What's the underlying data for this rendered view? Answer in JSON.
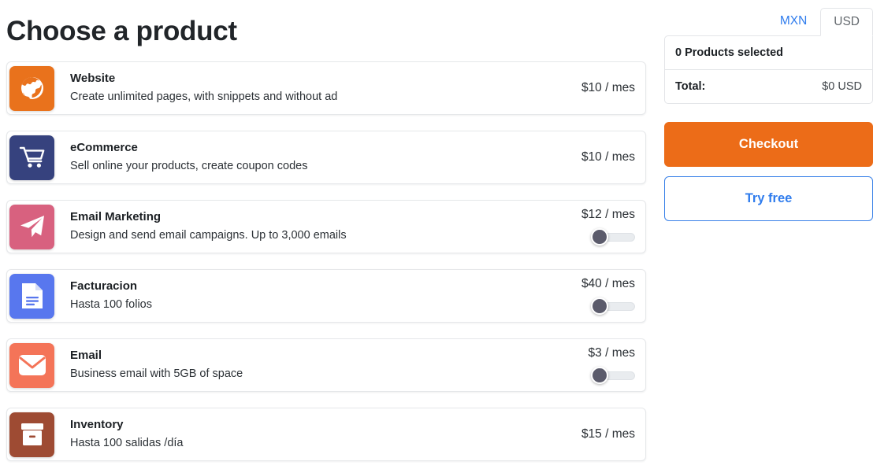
{
  "page": {
    "title": "Choose a product",
    "background": "#ffffff"
  },
  "colors": {
    "accent_orange": "#ec6c18",
    "accent_blue": "#2f7ced",
    "text": "#212529",
    "card_border": "#e6e8ea"
  },
  "products": [
    {
      "icon": "globe-icon",
      "icon_bg": "#e9721c",
      "name": "Website",
      "description": "Create unlimited pages, with snippets and without ad",
      "price": "$10 / mes",
      "has_toggle": false,
      "toggle_state": "off"
    },
    {
      "icon": "shopping-cart-icon",
      "icon_bg": "#36427e",
      "name": "eCommerce",
      "description": "Sell online your products, create coupon codes",
      "price": "$10 / mes",
      "has_toggle": false,
      "toggle_state": "off"
    },
    {
      "icon": "paper-plane-icon",
      "icon_bg": "#d8617f",
      "name": "Email Marketing",
      "description": "Design and send email campaigns. Up to 3,000 emails",
      "price": "$12 / mes",
      "has_toggle": true,
      "toggle_state": "off"
    },
    {
      "icon": "document-icon",
      "icon_bg": "#5877ee",
      "name": "Facturacion",
      "description": "Hasta 100 folios",
      "price": "$40 / mes",
      "has_toggle": true,
      "toggle_state": "off"
    },
    {
      "icon": "envelope-icon",
      "icon_bg": "#f47458",
      "name": "Email",
      "description": "Business email with 5GB of space",
      "price": "$3 / mes",
      "has_toggle": true,
      "toggle_state": "off"
    },
    {
      "icon": "box-icon",
      "icon_bg": "#9e4b33",
      "name": "Inventory",
      "description": "Hasta 100 salidas /día",
      "price": "$15 / mes",
      "has_toggle": false,
      "toggle_state": "off"
    }
  ],
  "sidebar": {
    "currency_tabs": [
      {
        "label": "MXN",
        "active": false
      },
      {
        "label": "USD",
        "active": true
      }
    ],
    "summary": {
      "products_selected": "0 Products selected",
      "total_label": "Total:",
      "total_value": "$0 USD"
    },
    "checkout_label": "Checkout",
    "try_free_label": "Try free"
  }
}
